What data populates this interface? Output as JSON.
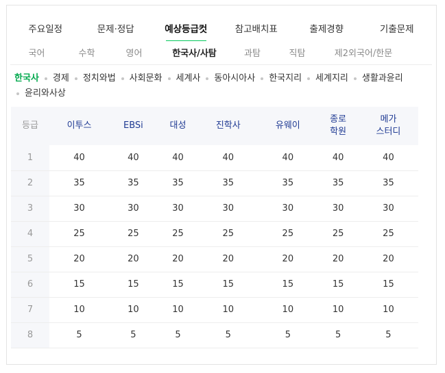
{
  "main_tabs": [
    "주요일정",
    "문제·정답",
    "예상등급컷",
    "참고배치표",
    "출제경향",
    "기출문제"
  ],
  "sub_tabs": [
    "국어",
    "수학",
    "영어",
    "한국사/사탐",
    "과탐",
    "직탐",
    "제2외국어/한문"
  ],
  "subjects": [
    "한국사",
    "경제",
    "정치와법",
    "사회문화",
    "세계사",
    "동아시아사",
    "한국지리",
    "세계지리",
    "생활과윤리",
    "윤리와사상"
  ],
  "table": {
    "grade_header": "등급",
    "columns": [
      {
        "line1": "이투스",
        "line2": ""
      },
      {
        "line1": "EBSi",
        "line2": ""
      },
      {
        "line1": "대성",
        "line2": ""
      },
      {
        "line1": "진학사",
        "line2": ""
      },
      {
        "line1": "유웨이",
        "line2": ""
      },
      {
        "line1": "종로",
        "line2": "학원"
      },
      {
        "line1": "메가",
        "line2": "스터디"
      }
    ],
    "rows": [
      [
        "1",
        "40",
        "40",
        "40",
        "40",
        "40",
        "40",
        "40"
      ],
      [
        "2",
        "35",
        "35",
        "35",
        "35",
        "35",
        "35",
        "35"
      ],
      [
        "3",
        "30",
        "30",
        "30",
        "30",
        "30",
        "30",
        "30"
      ],
      [
        "4",
        "25",
        "25",
        "25",
        "25",
        "25",
        "25",
        "25"
      ],
      [
        "5",
        "20",
        "20",
        "20",
        "20",
        "20",
        "20",
        "20"
      ],
      [
        "6",
        "15",
        "15",
        "15",
        "15",
        "15",
        "15",
        "15"
      ],
      [
        "7",
        "10",
        "10",
        "10",
        "10",
        "10",
        "10",
        "10"
      ],
      [
        "8",
        "5",
        "5",
        "5",
        "5",
        "5",
        "5",
        "5"
      ]
    ]
  },
  "colors": {
    "accent": "#03c75a",
    "header_text": "#1f3a93"
  }
}
